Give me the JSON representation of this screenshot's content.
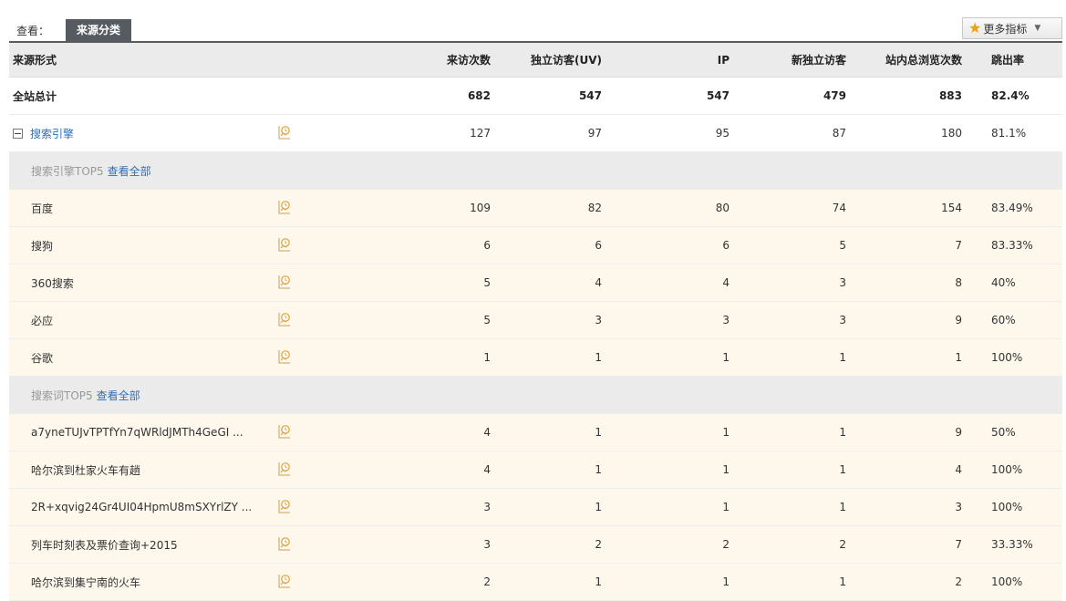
{
  "toolbar": {
    "view_label": "查看：",
    "active_tab": "来源分类",
    "more_metrics": "更多指标"
  },
  "headers": [
    "来源形式",
    "来访次数",
    "独立访客(UV)",
    "IP",
    "新独立访客",
    "站内总浏览次数",
    "跳出率"
  ],
  "total": {
    "name": "全站总计",
    "values": [
      "682",
      "547",
      "547",
      "479",
      "883",
      "82.4%"
    ]
  },
  "group": {
    "name": "搜索引擎",
    "values": [
      "127",
      "97",
      "95",
      "87",
      "180",
      "81.1%"
    ]
  },
  "engines_header": {
    "label": "搜索引擎TOP5",
    "link": "查看全部"
  },
  "engines": [
    {
      "name": "百度",
      "values": [
        "109",
        "82",
        "80",
        "74",
        "154",
        "83.49%"
      ]
    },
    {
      "name": "搜狗",
      "values": [
        "6",
        "6",
        "6",
        "5",
        "7",
        "83.33%"
      ]
    },
    {
      "name": "360搜索",
      "values": [
        "5",
        "4",
        "4",
        "3",
        "8",
        "40%"
      ]
    },
    {
      "name": "必应",
      "values": [
        "5",
        "3",
        "3",
        "3",
        "9",
        "60%"
      ]
    },
    {
      "name": "谷歌",
      "values": [
        "1",
        "1",
        "1",
        "1",
        "1",
        "100%"
      ]
    }
  ],
  "keywords_header": {
    "label": "搜索词TOP5",
    "link": "查看全部"
  },
  "keywords": [
    {
      "name": "a7yneTUJvTPTfYn7qWRldJMTh4GeGI ...",
      "values": [
        "4",
        "1",
        "1",
        "1",
        "9",
        "50%"
      ]
    },
    {
      "name": "哈尔滨到杜家火车有趟",
      "values": [
        "4",
        "1",
        "1",
        "1",
        "4",
        "100%"
      ]
    },
    {
      "name": "2R+xqvig24Gr4UI04HpmU8mSXYrlZY ...",
      "values": [
        "3",
        "1",
        "1",
        "1",
        "3",
        "100%"
      ]
    },
    {
      "name": "列车时刻表及票价查询+2015",
      "values": [
        "3",
        "2",
        "2",
        "2",
        "7",
        "33.33%"
      ]
    },
    {
      "name": "哈尔滨到集宁南的火车",
      "values": [
        "2",
        "1",
        "1",
        "1",
        "2",
        "100%"
      ]
    }
  ],
  "icons": {
    "trend": "trend-clock-icon",
    "collapse": "collapse-minus-icon",
    "star": "star-icon",
    "caret": "caret-down-icon"
  },
  "colors": {
    "link": "#2d6fb7",
    "row_bg": "#fdf7ec",
    "header_bg": "#ebebeb",
    "tab_bg": "#555b61",
    "star": "#f0a000"
  }
}
